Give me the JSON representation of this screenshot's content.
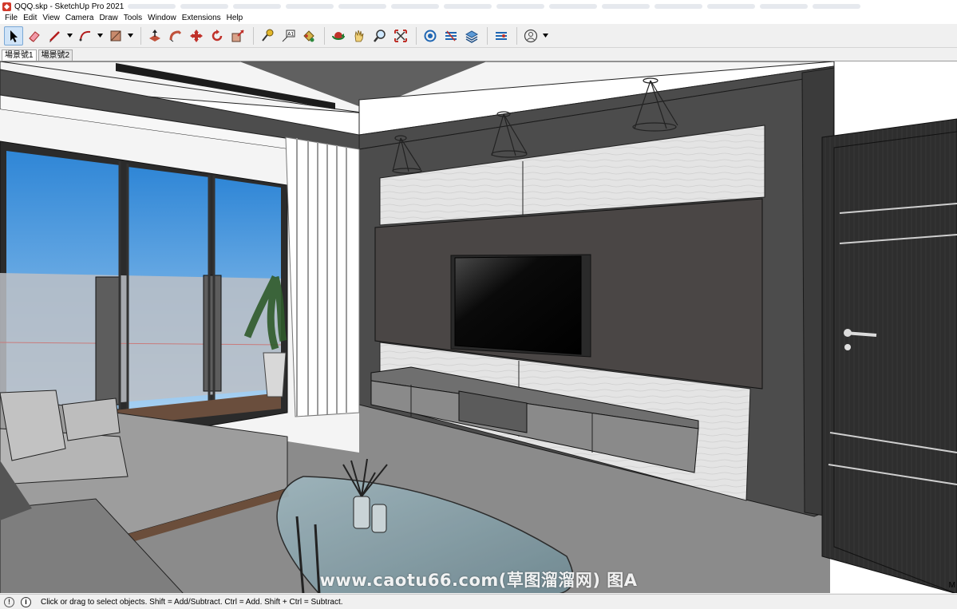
{
  "window": {
    "title": "QQQ.skp - SketchUp Pro 2021"
  },
  "menu": [
    "File",
    "Edit",
    "View",
    "Camera",
    "Draw",
    "Tools",
    "Window",
    "Extensions",
    "Help"
  ],
  "toolbar": {
    "tools": [
      "select-arrow-icon",
      "eraser-icon",
      "pencil-line-icon",
      "arc-icon",
      "shape-rectangle-icon",
      "push-pull-icon",
      "follow-me-icon",
      "move-icon",
      "rotate-icon",
      "scale-icon",
      "tape-measure-icon",
      "text-label-icon",
      "paint-bucket-icon",
      "orbit-icon",
      "pan-hand-icon",
      "zoom-icon",
      "zoom-extents-icon",
      "warehouse-icon",
      "extension-warehouse-icon",
      "layers-icon",
      "model-info-icon",
      "profile-icon"
    ]
  },
  "scene_tabs": [
    {
      "label": "場景號1",
      "active": true
    },
    {
      "label": "場景號2",
      "active": false
    }
  ],
  "viewport": {
    "watermark": "www.caotu66.com(草图溜溜网) 图A",
    "side_label": "M"
  },
  "status": {
    "text": "Click or drag to select objects. Shift = Add/Subtract. Ctrl = Add. Shift + Ctrl = Subtract.",
    "warn_symbol": "!",
    "info_symbol": "i"
  },
  "colors": {
    "wall_dark": "#4b4b4b",
    "accent_select": "#cfe3f7",
    "sky": "#5fa7e3"
  }
}
